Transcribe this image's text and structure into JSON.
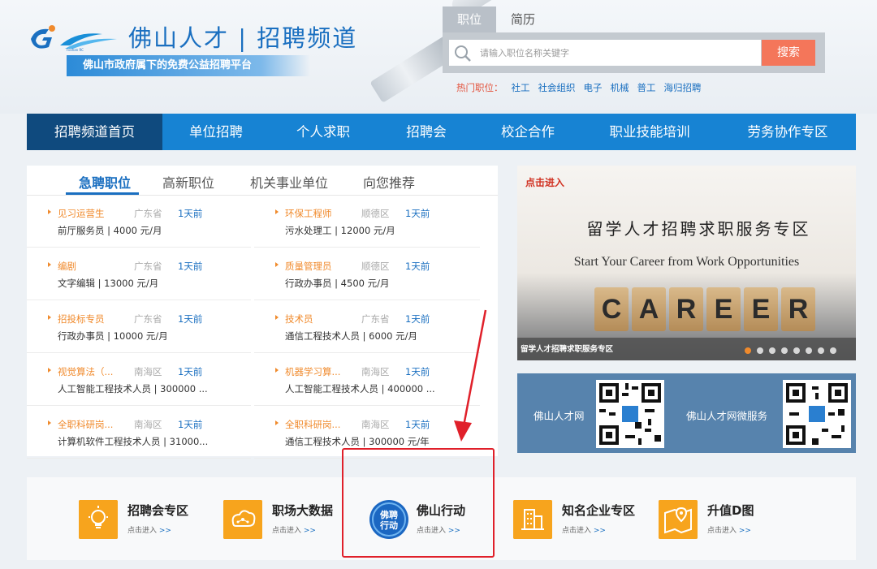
{
  "header": {
    "logo_title": "佛山人才 | 招聘频道",
    "logo_subtitle": "佛山市政府属下的免费公益招聘平台"
  },
  "search": {
    "tabs": [
      {
        "label": "职位",
        "active": true
      },
      {
        "label": "简历",
        "active": false
      }
    ],
    "placeholder": "请输入职位名称关键字",
    "button_label": "搜索",
    "hot_label": "热门职位：",
    "hot_items": [
      "社工",
      "社会组织",
      "电子",
      "机械",
      "普工",
      "海归招聘"
    ]
  },
  "nav": {
    "items": [
      {
        "label": "招聘频道首页",
        "active": true
      },
      {
        "label": "单位招聘",
        "active": false
      },
      {
        "label": "个人求职",
        "active": false
      },
      {
        "label": "招聘会",
        "active": false
      },
      {
        "label": "校企合作",
        "active": false
      },
      {
        "label": "职业技能培训",
        "active": false
      },
      {
        "label": "劳务协作专区",
        "active": false
      }
    ]
  },
  "jobs": {
    "tabs": [
      {
        "label": "急聘职位",
        "active": true
      },
      {
        "label": "高新职位",
        "active": false
      },
      {
        "label": "机关事业单位",
        "active": false
      },
      {
        "label": "向您推荐",
        "active": false
      }
    ],
    "list": [
      {
        "title": "见习运营生",
        "area": "广东省",
        "time": "1天前",
        "desc": "前厅服务员 | 4000 元/月"
      },
      {
        "title": "环保工程师",
        "area": "顺德区",
        "time": "1天前",
        "desc": "污水处理工 | 12000 元/月"
      },
      {
        "title": "编剧",
        "area": "广东省",
        "time": "1天前",
        "desc": "文字编辑 | 13000 元/月"
      },
      {
        "title": "质量管理员",
        "area": "顺德区",
        "time": "1天前",
        "desc": "行政办事员 | 4500 元/月"
      },
      {
        "title": "招投标专员",
        "area": "广东省",
        "time": "1天前",
        "desc": "行政办事员 | 10000 元/月"
      },
      {
        "title": "技术员",
        "area": "广东省",
        "time": "1天前",
        "desc": "通信工程技术人员 | 6000 元/月"
      },
      {
        "title": "视觉算法（...",
        "area": "南海区",
        "time": "1天前",
        "desc": "人工智能工程技术人员 | 300000 ..."
      },
      {
        "title": "机器学习算...",
        "area": "南海区",
        "time": "1天前",
        "desc": "人工智能工程技术人员 | 400000 ..."
      },
      {
        "title": "全职科研岗...",
        "area": "南海区",
        "time": "1天前",
        "desc": "计算机软件工程技术人员 | 31000..."
      },
      {
        "title": "全职科研岗...",
        "area": "南海区",
        "time": "1天前",
        "desc": "通信工程技术人员 | 300000 元/年"
      }
    ]
  },
  "banner": {
    "enter": "点击进入",
    "title": "留学人才招聘求职服务专区",
    "subtitle": "Start Your Career from Work Opportunities",
    "blocks": [
      "C",
      "A",
      "R",
      "E",
      "E",
      "R"
    ],
    "caption": "留学人才招聘求职服务专区",
    "dot_count": 8,
    "active_dot": 0
  },
  "qr": {
    "left_label": "佛山人才网",
    "right_label": "佛山人才网微服务"
  },
  "quick_links": [
    {
      "title": "招聘会专区",
      "enter": "点击进入",
      "arrow": ">>",
      "icon": "bulb-icon"
    },
    {
      "title": "职场大数据",
      "enter": "点击进入",
      "arrow": ">>",
      "icon": "cloud-network-icon"
    },
    {
      "title": "佛山行动",
      "enter": "点击进入",
      "arrow": ">>",
      "icon": "foshan-action-logo",
      "logo_text": "佛聘行动"
    },
    {
      "title": "知名企业专区",
      "enter": "点击进入",
      "arrow": ">>",
      "icon": "building-icon"
    },
    {
      "title": "升值D图",
      "enter": "点击进入",
      "arrow": ">>",
      "icon": "map-pin-icon"
    }
  ],
  "colors": {
    "nav_blue": "#1783d3",
    "nav_active": "#0f4a7e",
    "accent_orange": "#f08a2c",
    "link_blue": "#1a6fc0",
    "search_button": "#f4765a",
    "annotation_red": "#e0202a"
  }
}
